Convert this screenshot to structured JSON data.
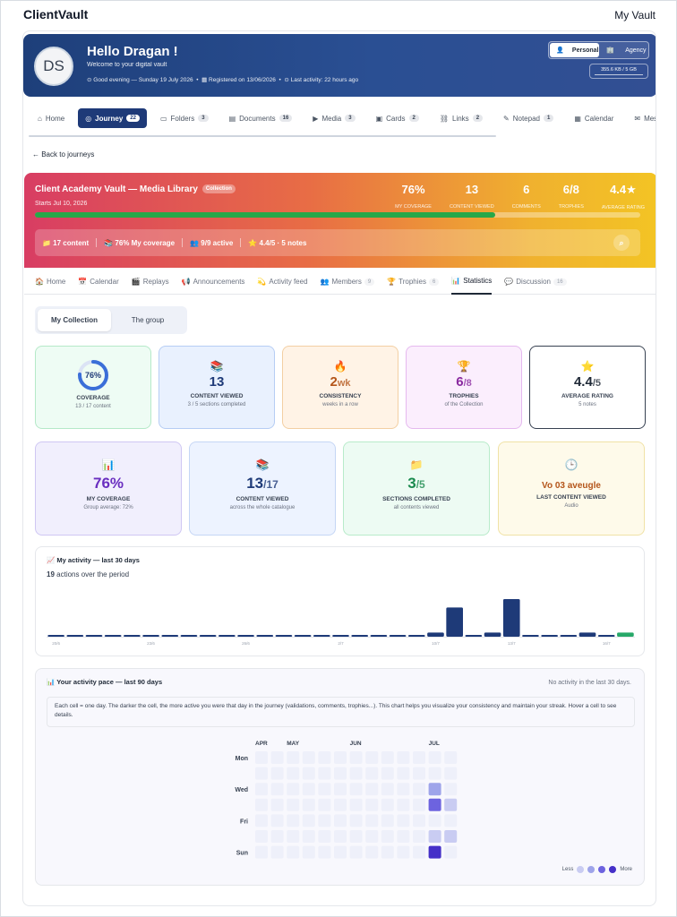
{
  "app": {
    "brand": "ClientVault",
    "top_right_link": "My Vault"
  },
  "user": {
    "initials": "DS",
    "greeting": "Hello Dragan !",
    "welcome": "Welcome to your digital vault",
    "good_evening": "Good evening — Sunday 19 July 2026",
    "registered": "Registered on 13/06/2026",
    "last_activity": "Last activity: 22 hours ago",
    "mode_personal": "Personal",
    "mode_agency": "Agency",
    "storage": "355.6 KB / 5 GB"
  },
  "nav_tabs": [
    {
      "label": "Home",
      "badge": "",
      "icon": "home-icon"
    },
    {
      "label": "Journey",
      "badge": "22",
      "icon": "journey-icon"
    },
    {
      "label": "Folders",
      "badge": "3",
      "icon": "folder-icon"
    },
    {
      "label": "Documents",
      "badge": "16",
      "icon": "document-icon"
    },
    {
      "label": "Media",
      "badge": "3",
      "icon": "media-icon"
    },
    {
      "label": "Cards",
      "badge": "2",
      "icon": "card-icon"
    },
    {
      "label": "Links",
      "badge": "2",
      "icon": "link-icon"
    },
    {
      "label": "Notepad",
      "badge": "1",
      "icon": "notepad-icon"
    },
    {
      "label": "Calendar",
      "badge": "",
      "icon": "calendar-icon"
    },
    {
      "label": "Messages",
      "badge": "",
      "icon": "message-icon"
    }
  ],
  "back_link": "← Back to journeys",
  "course": {
    "title": "Client Academy Vault — Media Library",
    "tag": "Collection",
    "starts": "Starts Jul 10, 2026",
    "progress": 0.76,
    "stats": [
      {
        "value": "76%",
        "label": "My coverage"
      },
      {
        "value": "13",
        "label": "Content viewed"
      },
      {
        "value": "6",
        "label": "Comments"
      },
      {
        "value": "6/8",
        "label": "Trophies"
      },
      {
        "value": "4.4★",
        "label": "Average rating"
      }
    ],
    "chips": [
      "📁 17 content",
      "📚 76% My coverage",
      "👥 9/9 active",
      "⭐ 4.4/5 · 5 notes"
    ]
  },
  "sub_tabs": [
    {
      "label": "Home",
      "badge": "",
      "icon": "🏠"
    },
    {
      "label": "Calendar",
      "badge": "",
      "icon": "📅"
    },
    {
      "label": "Replays",
      "badge": "",
      "icon": "🎬"
    },
    {
      "label": "Announcements",
      "badge": "",
      "icon": "📢"
    },
    {
      "label": "Activity feed",
      "badge": "",
      "icon": "💫"
    },
    {
      "label": "Members",
      "badge": "9",
      "icon": "👥"
    },
    {
      "label": "Trophies",
      "badge": "6",
      "icon": "🏆"
    },
    {
      "label": "Statistics",
      "badge": "",
      "icon": "📊"
    },
    {
      "label": "Discussion",
      "badge": "16",
      "icon": "💬"
    }
  ],
  "view_toggle": [
    "My Collection",
    "The group"
  ],
  "cards_row1": [
    {
      "icon": "",
      "value": "76%",
      "label": "Coverage",
      "sub": "13 / 17 content"
    },
    {
      "icon": "📚",
      "value": "13",
      "label": "Content viewed",
      "sub": "3 / 5 sections completed"
    },
    {
      "icon": "🔥",
      "value": "2",
      "unit": "wk",
      "label": "Consistency",
      "sub": "weeks in a row"
    },
    {
      "icon": "🏆",
      "value": "6",
      "unit": "/8",
      "label": "Trophies",
      "sub": "of the Collection"
    },
    {
      "icon": "⭐",
      "value": "4.4",
      "unit": "/5",
      "label": "Average rating",
      "sub": "5 notes"
    }
  ],
  "cards_row2": [
    {
      "icon": "📊",
      "value": "76%",
      "unit": "",
      "label": "My coverage",
      "sub": "Group average: 72%"
    },
    {
      "icon": "📚",
      "value": "13",
      "unit": "/17",
      "label": "Content viewed",
      "sub": "across the whole catalogue"
    },
    {
      "icon": "📁",
      "value": "3",
      "unit": "/5",
      "label": "Sections completed",
      "sub": "all contents viewed"
    },
    {
      "icon": "🕒",
      "value": "Vo 03 aveugle",
      "unit": "",
      "label": "Last content viewed",
      "sub": "Audio"
    }
  ],
  "activity": {
    "title": "📈 My activity — last 30 days",
    "count": "19",
    "count_suffix": "actions over the period"
  },
  "chart_data": {
    "type": "bar",
    "title": "My activity — last 30 days",
    "x_ticks": [
      "20/6",
      "23/6",
      "26/6",
      "2/7",
      "10/7",
      "13/7",
      "16/7"
    ],
    "values": [
      0,
      0,
      0,
      0,
      0,
      0,
      0,
      0,
      0,
      0,
      0,
      0,
      0,
      0,
      0,
      0,
      0,
      0,
      0,
      0,
      1,
      7,
      0,
      1,
      9,
      0,
      0,
      0,
      1,
      0,
      1
    ],
    "highlight_last": true,
    "bar_color": "#1e3a78",
    "last_color": "#27a869"
  },
  "pace": {
    "title": "📊 Your activity pace — last 90 days",
    "no_activity": "No activity in the last 30 days.",
    "note": "Each cell = one day. The darker the cell, the more active you were that day in the journey (validations, comments, trophies...). This chart helps you visualize your consistency and maintain your streak. Hover a cell to see details.",
    "months": [
      "APR",
      "MAY",
      "JUN",
      "JUL"
    ],
    "days": [
      "Mon",
      "Wed",
      "Fri",
      "Sun"
    ],
    "legend_less": "Less",
    "legend_more": "More"
  },
  "heatmap_data": {
    "weeks": 13,
    "active": [
      {
        "week": 11,
        "day": 2,
        "level": 2
      },
      {
        "week": 11,
        "day": 3,
        "level": 3
      },
      {
        "week": 12,
        "day": 3,
        "level": 1
      },
      {
        "week": 11,
        "day": 5,
        "level": 1
      },
      {
        "week": 12,
        "day": 5,
        "level": 1
      },
      {
        "week": 11,
        "day": 6,
        "level": 4
      }
    ],
    "colors": [
      "#eef0fa",
      "#c9ccf2",
      "#9ea4ea",
      "#6d63df",
      "#4530c8"
    ]
  }
}
